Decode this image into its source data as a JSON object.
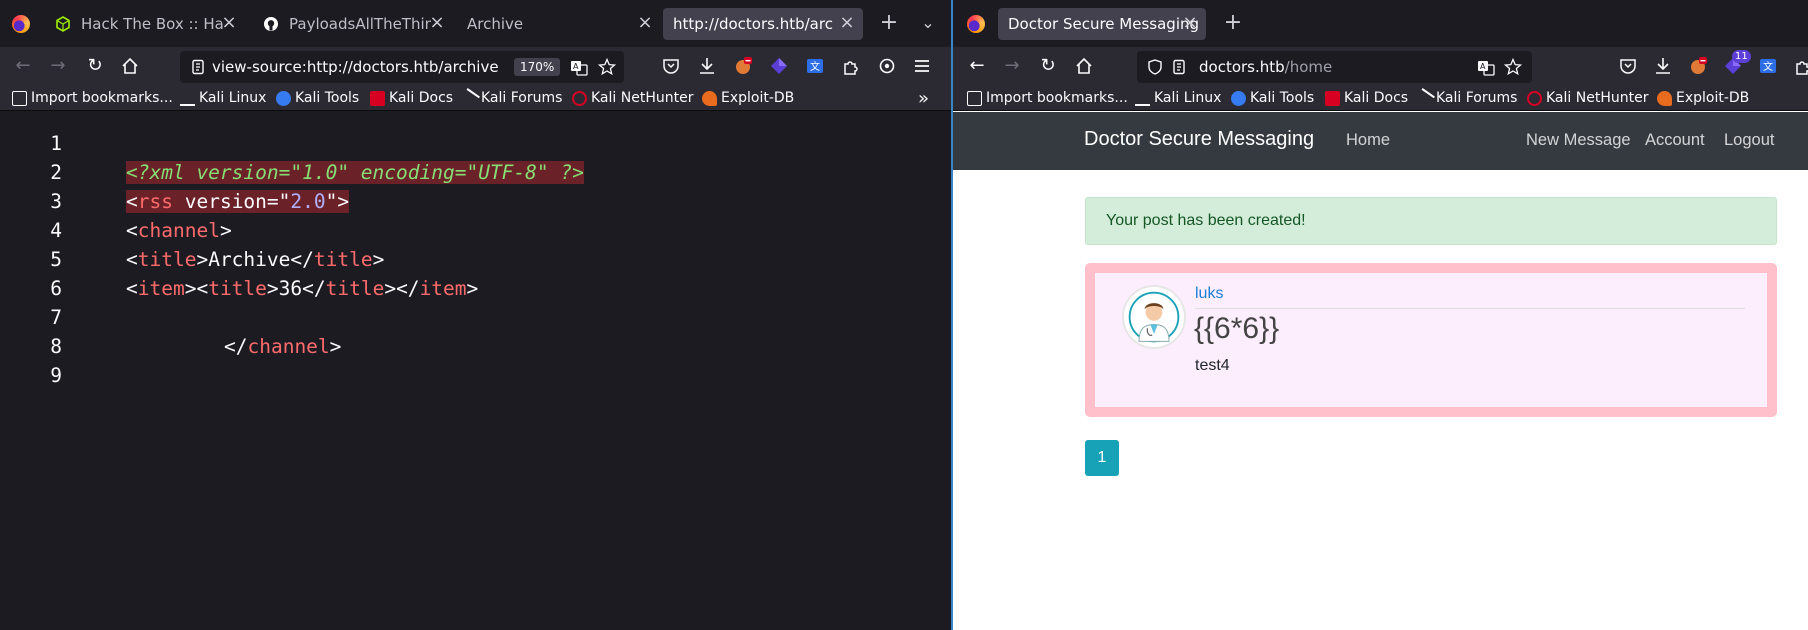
{
  "left_window": {
    "tabs": [
      {
        "label": "Hack The Box :: Hack",
        "icon": "htb-cube-icon"
      },
      {
        "label": "PayloadsAllTheThings",
        "icon": "github-icon"
      },
      {
        "label": "Archive",
        "icon": ""
      },
      {
        "label": "http://doctors.htb/archive",
        "icon": ""
      }
    ],
    "active_tab": 3,
    "url": "view-source:http://doctors.htb/archive",
    "zoom": "170%",
    "bookmarks": [
      "Import bookmarks...",
      "Kali Linux",
      "Kali Tools",
      "Kali Docs",
      "Kali Forums",
      "Kali NetHunter",
      "Exploit-DB"
    ],
    "source_lines": {
      "numbers": [
        "1",
        "2",
        "3",
        "4",
        "5",
        "6",
        "7",
        "8",
        "9"
      ],
      "l2": "<?xml version=\"1.0\" encoding=\"UTF-8\" ?>",
      "l3_tag": "rss",
      "l3_attr": "version",
      "l3_val": "2.0",
      "l4_tag": "channel",
      "l5_tag": "title",
      "l5_text": "Archive",
      "l6_item": "item",
      "l6_title": "title",
      "l6_text": "36",
      "l8_tag": "channel"
    }
  },
  "right_window": {
    "tab": {
      "label": "Doctor Secure Messaging"
    },
    "url_host": "doctors.htb",
    "url_path": "/home",
    "extension_badge": "11",
    "bookmarks": [
      "Import bookmarks...",
      "Kali Linux",
      "Kali Tools",
      "Kali Docs",
      "Kali Forums",
      "Kali NetHunter",
      "Exploit-DB"
    ],
    "site": {
      "brand": "Doctor Secure Messaging",
      "nav_home": "Home",
      "nav_new_message": "New Message",
      "nav_account": "Account",
      "nav_logout": "Logout",
      "alert": "Your post has been created!",
      "post": {
        "author": "luks",
        "title": "{{6*6}}",
        "body": "test4"
      },
      "page_number": "1"
    }
  },
  "colors": {
    "chrome_bg": "#1c1b22",
    "toolbar_bg": "#2b2a33",
    "accent": "#3a85c9",
    "alert_green": "#d4edda",
    "post_border": "#ffc0cb",
    "pager": "#17a2b8"
  }
}
